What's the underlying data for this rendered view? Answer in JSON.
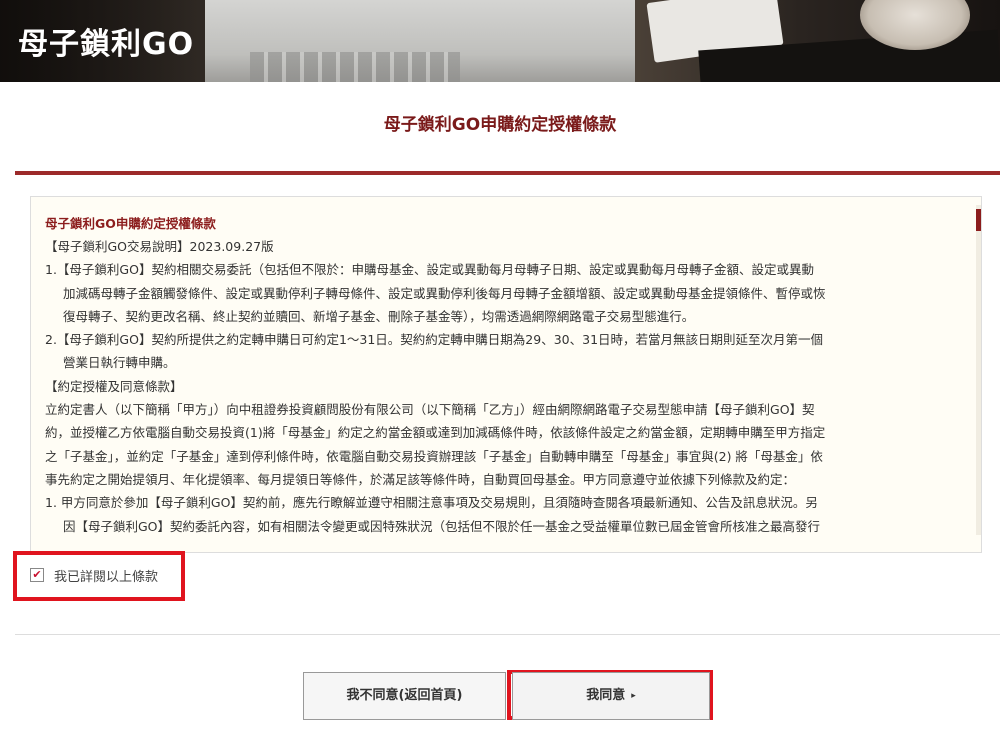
{
  "header": {
    "brand": "母子鎖利GO"
  },
  "page": {
    "title": "母子鎖利GO申購約定授權條款"
  },
  "terms": {
    "heading": "母子鎖利GO申購約定授權條款",
    "version_line": "【母子鎖利GO交易說明】2023.09.27版",
    "item1_line1": "1.【母子鎖利GO】契約相關交易委託（包括但不限於：申購母基金、設定或異動每月母轉子日期、設定或異動每月母轉子金額、設定或異動",
    "item1_line2": "加減碼母轉子金額觸發條件、設定或異動停利子轉母條件、設定或異動停利後每月母轉子金額增額、設定或異動母基金提領條件、暫停或恢",
    "item1_line3": "復母轉子、契約更改名稱、終止契約並贖回、新增子基金、刪除子基金等），均需透過網際網路電子交易型態進行。",
    "item2_line1": "2.【母子鎖利GO】契約所提供之約定轉申購日可約定1～31日。契約約定轉申購日期為29、30、31日時，若當月無該日期則延至次月第一個",
    "item2_line2": "營業日執行轉申購。",
    "section2": "【約定授權及同意條款】",
    "para_line1": "立約定書人（以下簡稱「甲方」）向中租證券投資顧問股份有限公司（以下簡稱「乙方」）經由網際網路電子交易型態申請【母子鎖利GO】契",
    "para_line2": "約，並授權乙方依電腦自動交易投資(1)將「母基金」約定之約當金額或達到加減碼條件時，依該條件設定之約當金額，定期轉申購至甲方指定",
    "para_line3": "之「子基金」，並約定「子基金」達到停利條件時，依電腦自動交易投資辦理該「子基金」自動轉申購至「母基金」事宜與(2) 將「母基金」依",
    "para_line4": "事先約定之開始提領月、年化提領率、每月提領日等條件，於滿足該等條件時，自動買回母基金。甲方同意遵守並依據下列條款及約定：",
    "item3_line1": "1. 甲方同意於參加【母子鎖利GO】契約前，應先行瞭解並遵守相關注意事項及交易規則，且須隨時查閱各項最新通知、公告及訊息狀況。另",
    "item3_line2": "因【母子鎖利GO】契約委託內容，如有相關法令變更或因特殊狀況（包括但不限於任一基金之受益權單位數已屆金管會所核准之最高發行"
  },
  "agreement": {
    "checkbox_label": "我已詳閱以上條款",
    "checked": true,
    "check_mark": "✔"
  },
  "buttons": {
    "decline_label": "我不同意(返回首頁)",
    "agree_label": "我同意",
    "agree_arrow": "▸"
  },
  "colors": {
    "accent": "#9c2a2a",
    "heading": "#8c1d1d",
    "highlight": "#e0141e"
  }
}
